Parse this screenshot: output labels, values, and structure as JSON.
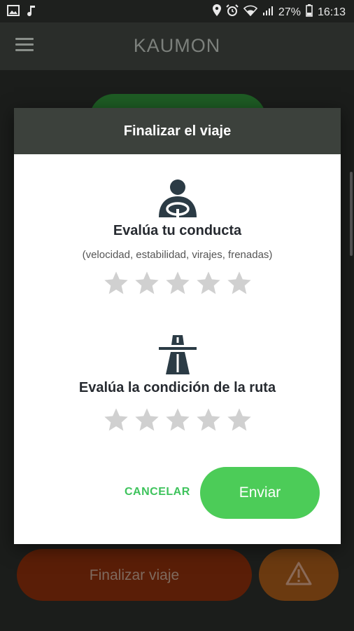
{
  "status_bar": {
    "battery": "27%",
    "time": "16:13"
  },
  "app": {
    "title": "KAUMON"
  },
  "background": {
    "finish_button_label": "Finalizar viaje"
  },
  "dialog": {
    "title": "Finalizar el viaje",
    "conduct": {
      "title": "Evalúa tu conducta",
      "subtitle": "(velocidad, estabilidad, virajes, frenadas)",
      "rating": 0,
      "max_rating": 5
    },
    "route": {
      "title": "Evalúa la condición de la ruta",
      "rating": 0,
      "max_rating": 5
    },
    "cancel_label": "CANCELAR",
    "send_label": "Enviar"
  },
  "colors": {
    "accent_green": "#4ccc58",
    "dialog_header": "#3c413c",
    "star_inactive": "#d0d0d0",
    "icon_dark": "#2b3b45"
  }
}
